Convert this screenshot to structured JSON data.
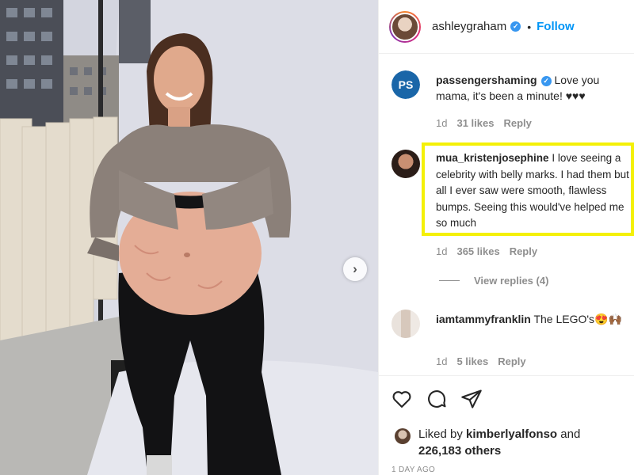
{
  "post": {
    "username": "ashleygraham",
    "follow_label": "Follow",
    "separator": "•",
    "verified_glyph": "✓",
    "next_glyph": "›"
  },
  "comments": [
    {
      "username": "passengershaming",
      "verified": true,
      "text": "Love you mama, it's been a minute! ♥♥♥",
      "age": "1d",
      "likes": "31 likes",
      "reply": "Reply",
      "avatar_label": "PS"
    },
    {
      "username": "mua_kristenjosephine",
      "verified": false,
      "text": "I love seeing a celebrity with belly marks. I had them but all I ever saw were smooth, flawless bumps. Seeing this would've helped me so much",
      "age": "1d",
      "likes": "365 likes",
      "reply": "Reply",
      "highlighted": true
    },
    {
      "username": "iamtammyfranklin",
      "verified": false,
      "text": "The LEGO's😍🙌🏾",
      "age": "1d",
      "likes": "5 likes",
      "reply": "Reply"
    }
  ],
  "view_replies": "View replies (4)",
  "actions": {
    "like_icon": "heart-icon",
    "comment_icon": "comment-icon",
    "share_icon": "share-icon"
  },
  "liked_by": {
    "prefix": "Liked by",
    "user": "kimberlyalfonso",
    "conjunction": "and",
    "others": "226,183 others"
  },
  "date": "1 DAY AGO",
  "colors": {
    "accent": "#0095f6",
    "verified": "#3897f0",
    "highlight": "#f4f007",
    "muted": "#8e8e8e"
  }
}
